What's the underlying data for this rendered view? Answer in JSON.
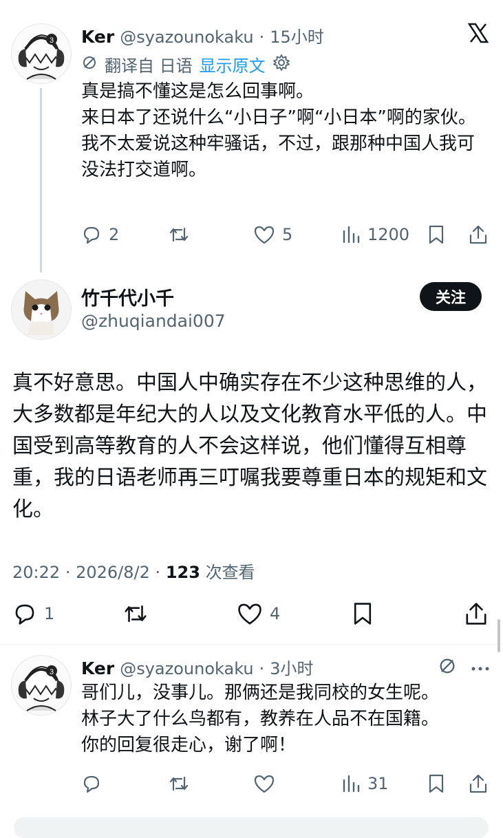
{
  "reply1": {
    "name": "Ker",
    "handle": "@syazounokaku",
    "time": "15小时",
    "translate_label": "翻译自 日语",
    "show_original": "显示原文",
    "text": "真是搞不懂这是怎么回事啊。\n来日本了还说什么“小日子”啊“小日本”啊的家伙。\n我不太爱说这种牢骚话，不过，跟那种中国人我可没法打交道啊。",
    "replies": "2",
    "retweets": "",
    "likes": "5",
    "views": "1200"
  },
  "main": {
    "name": "竹千代小千",
    "handle": "@zhuqiandai007",
    "follow_label": "关注",
    "text": "真不好意思。中国人中确实存在不少这种思维的人，大多数都是年纪大的人以及文化教育水平低的人。中国受到高等教育的人不会这样说，他们懂得互相尊重，我的日语老师再三叮嘱我要尊重日本的规矩和文化。",
    "time": "20:22",
    "date": "2026/8/2",
    "view_count": "123",
    "view_label": "次查看",
    "replies": "1",
    "retweets": "",
    "likes": "4"
  },
  "reply2": {
    "name": "Ker",
    "handle": "@syazounokaku",
    "time": "3小时",
    "text": "哥们儿，没事儿。那俩还是我同校的女生呢。\n林子大了什么鸟都有，教养在人品不在国籍。\n你的回复很走心，谢了啊！",
    "replies": "",
    "retweets": "",
    "likes": "",
    "views": "31"
  },
  "separators": {
    "dot": "·"
  },
  "colors": {
    "accent": "#1d9bf0",
    "text": "#0f1419",
    "muted": "#536471"
  }
}
